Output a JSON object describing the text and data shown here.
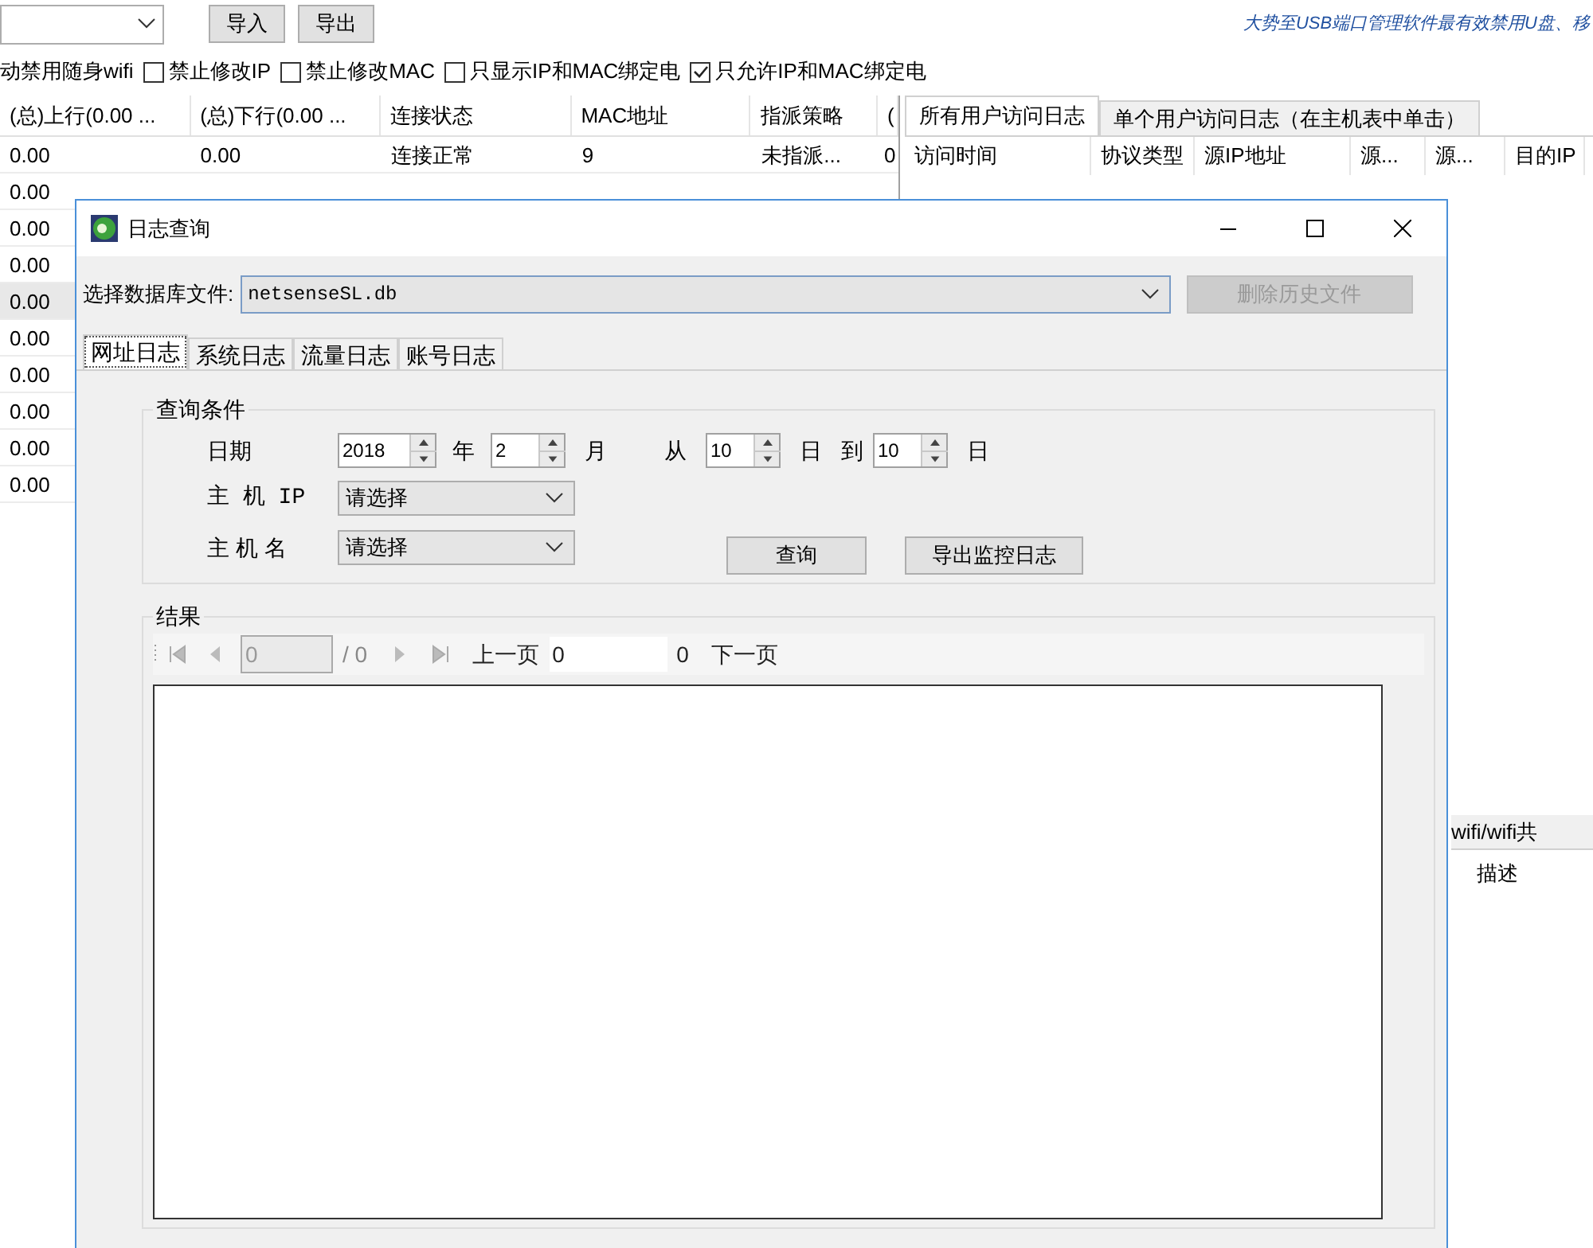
{
  "toolbar": {
    "buttons": [
      "导入",
      "导出"
    ],
    "banner": "大势至USB端口管理软件最有效禁用U盘、移"
  },
  "options": [
    {
      "kind": "text",
      "label": "动禁用随身wifi"
    },
    {
      "kind": "checkbox",
      "label": "禁止修改IP",
      "checked": false
    },
    {
      "kind": "checkbox",
      "label": "禁止修改MAC",
      "checked": false
    },
    {
      "kind": "checkbox",
      "label": "只显示IP和MAC绑定电",
      "checked": false
    },
    {
      "kind": "checkbox",
      "label": "只允许IP和MAC绑定电",
      "checked": true
    }
  ],
  "host_table": {
    "columns": [
      "(总)上行(0.00 ...",
      "(总)下行(0.00 ...",
      "连接状态",
      "MAC地址",
      "指派策略",
      "("
    ],
    "rows": [
      {
        "cells": [
          "0.00",
          "0.00",
          "连接正常",
          "9",
          "未指派...",
          "0"
        ],
        "selected": false
      },
      {
        "cells": [
          "0.00"
        ],
        "selected": false
      },
      {
        "cells": [
          "0.00"
        ],
        "selected": false
      },
      {
        "cells": [
          "0.00"
        ],
        "selected": false
      },
      {
        "cells": [
          "0.00"
        ],
        "selected": true
      },
      {
        "cells": [
          "0.00"
        ],
        "selected": false
      },
      {
        "cells": [
          "0.00"
        ],
        "selected": false
      },
      {
        "cells": [
          "0.00"
        ],
        "selected": false
      },
      {
        "cells": [
          "0.00"
        ],
        "selected": false
      },
      {
        "cells": [
          "0.00"
        ],
        "selected": false
      }
    ]
  },
  "log_pane": {
    "tabs": [
      {
        "label": "所有用户访问日志",
        "selected": true
      },
      {
        "label": "单个用户访问日志（在主机表中单击）",
        "selected": false
      }
    ],
    "columns": [
      "访问时间",
      "协议类型",
      "源IP地址",
      "源...",
      "源...",
      "目的IP"
    ]
  },
  "lower_pane": {
    "tab": "wifi/wifi共",
    "columns": [
      "描述"
    ]
  },
  "dialog": {
    "title": "日志查询",
    "db_label": "选择数据库文件:",
    "db_value": "netsenseSL.db",
    "delete_button": {
      "label": "删除历史文件",
      "disabled": true
    },
    "tabs": [
      {
        "label": "网址日志",
        "selected": true
      },
      {
        "label": "系统日志",
        "selected": false
      },
      {
        "label": "流量日志",
        "selected": false
      },
      {
        "label": "账号日志",
        "selected": false
      }
    ],
    "query_group": {
      "title": "查询条件",
      "date_label": "日期",
      "year": "2018",
      "year_unit": "年",
      "month": "2",
      "month_unit": "月",
      "from_label": "从",
      "from_day": "10",
      "from_unit": "日",
      "to_label": "到",
      "to_day": "10",
      "to_unit": "日",
      "host_ip_label": "主 机 IP",
      "host_ip_value": "请选择",
      "host_name_label": "主 机 名",
      "host_name_value": "请选择",
      "buttons": [
        "查询",
        "导出监控日志"
      ]
    },
    "results_group": {
      "title": "结果",
      "page_value": "0",
      "page_total": "/ 0",
      "prev": "上一页",
      "page_field": "0",
      "count": "0",
      "next": "下一页"
    }
  }
}
